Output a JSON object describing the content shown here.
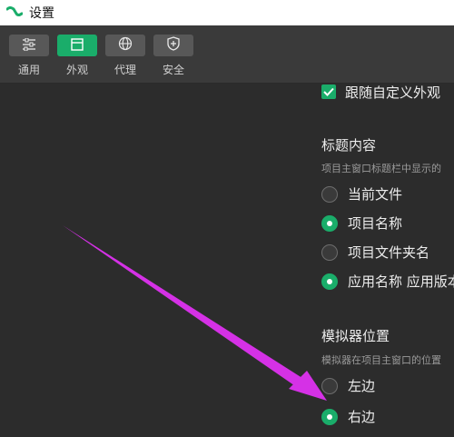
{
  "window": {
    "title": "设置"
  },
  "toolbar": {
    "tabs": [
      {
        "label": "通用",
        "icon": "sliders-icon",
        "active": false
      },
      {
        "label": "外观",
        "icon": "window-icon",
        "active": true
      },
      {
        "label": "代理",
        "icon": "globe-icon",
        "active": false
      },
      {
        "label": "安全",
        "icon": "shield-icon",
        "active": false
      }
    ]
  },
  "appearance": {
    "follow_custom": {
      "label": "跟随自定义外观",
      "checked": true
    }
  },
  "title_content": {
    "title": "标题内容",
    "description": "项目主窗口标题栏中显示的",
    "options": [
      {
        "label": "当前文件",
        "checked": false
      },
      {
        "label": "项目名称",
        "checked": true
      },
      {
        "label": "项目文件夹名",
        "checked": false
      },
      {
        "label": "应用名称 应用版本",
        "checked": true
      }
    ]
  },
  "simulator_position": {
    "title": "模拟器位置",
    "description": "模拟器在项目主窗口的位置",
    "options": [
      {
        "label": "左边",
        "checked": false
      },
      {
        "label": "右边",
        "checked": true
      }
    ]
  },
  "colors": {
    "accent": "#1aad6a",
    "annotation_arrow": "#d531e6"
  }
}
